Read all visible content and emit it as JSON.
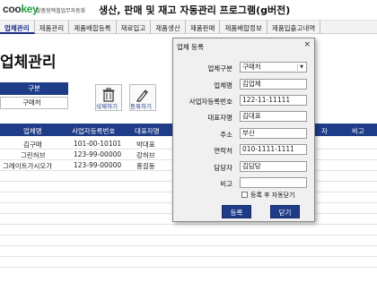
{
  "header": {
    "logo_a": "coo",
    "logo_b": "key",
    "tagline": "맞춤형엑셀업무자동화",
    "title": "생산, 판매 및 재고 자동관리 프로그램(g버전)"
  },
  "menu": [
    {
      "label": "업체관리",
      "active": true
    },
    {
      "label": "제품관리",
      "active": false
    },
    {
      "label": "제품배합등록",
      "active": false
    },
    {
      "label": "재료입고",
      "active": false
    },
    {
      "label": "제품생산",
      "active": false
    },
    {
      "label": "제품판매",
      "active": false
    },
    {
      "label": "제품배합정보",
      "active": false
    },
    {
      "label": "제품입출고내역",
      "active": false
    }
  ],
  "page": {
    "title": "업체관리"
  },
  "filter": {
    "label": "구분",
    "value": "구매처"
  },
  "toolbar": {
    "delete_label": "삭제하기",
    "register_label": "등록하기"
  },
  "table": {
    "columns": [
      "업체명",
      "사업자등록번호",
      "대표자명",
      "자",
      "비고"
    ],
    "rows": [
      {
        "name": "김구매",
        "biz_no": "101-00-10101",
        "ceo": "박대표"
      },
      {
        "name": "그린허브",
        "biz_no": "123-99-00000",
        "ceo": "강허브"
      },
      {
        "name": "그레이트가시오가",
        "biz_no": "123-99-00000",
        "ceo": "홍길동"
      }
    ]
  },
  "dialog": {
    "title": "업체 등록",
    "close": "×",
    "fields": {
      "type": {
        "label": "업체구분",
        "value": "구매처"
      },
      "name": {
        "label": "업체명",
        "value": "김업체"
      },
      "biz_no": {
        "label": "사업자등록번호",
        "value": "122-11-11111"
      },
      "ceo": {
        "label": "대표자명",
        "value": "김대표"
      },
      "address": {
        "label": "주소",
        "value": "부산"
      },
      "phone": {
        "label": "연락처",
        "value": "010-1111-1111"
      },
      "manager": {
        "label": "담당자",
        "value": "김담당"
      },
      "note": {
        "label": "비고",
        "value": ""
      }
    },
    "checkbox_label": "등록 후 자동닫기",
    "checkbox_checked": false,
    "submit_label": "등록",
    "close_label": "닫기"
  },
  "colors": {
    "accent": "#1f3c88",
    "brand_green": "#1fa23a"
  }
}
